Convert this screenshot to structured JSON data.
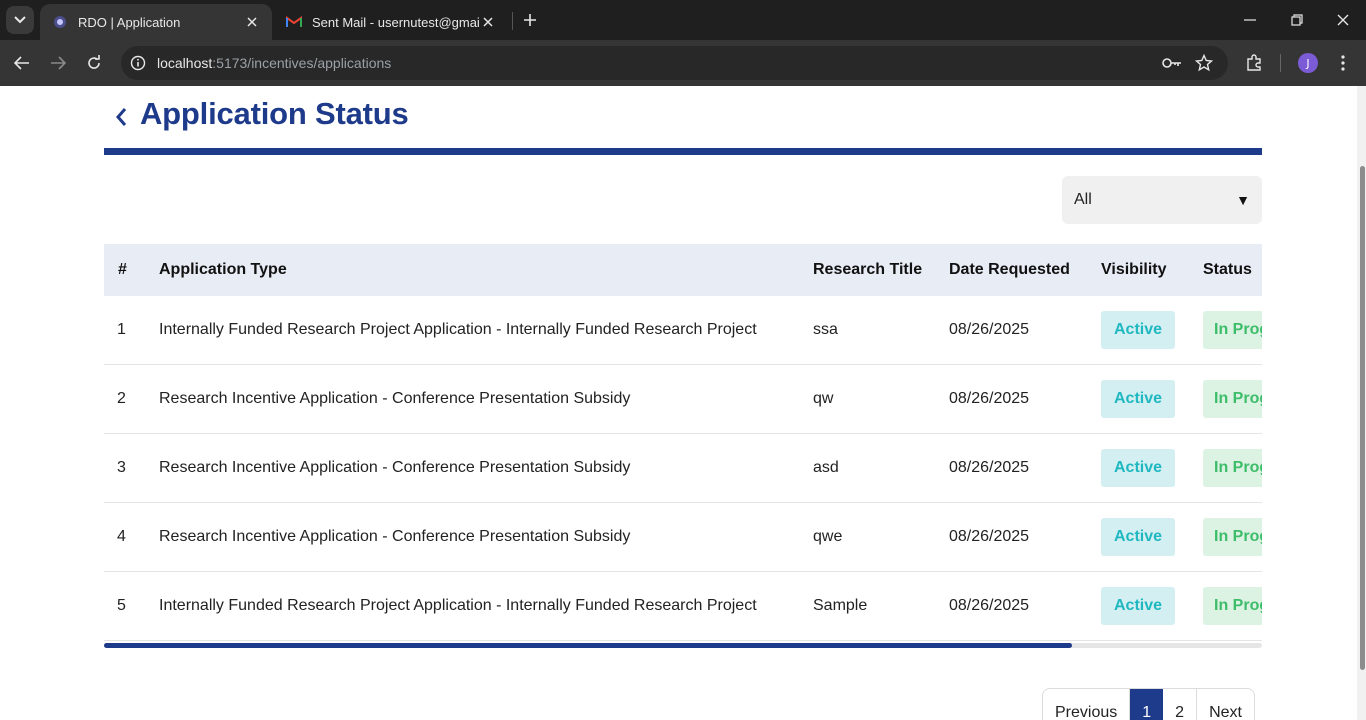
{
  "browser": {
    "tabs": [
      {
        "title": "RDO | Application",
        "active": true
      },
      {
        "title": "Sent Mail - usernutest@gmail.c",
        "active": false
      }
    ],
    "url_host": "localhost",
    "url_rest": ":5173/incentives/applications",
    "profile_initial": "J"
  },
  "page": {
    "title": "Application Status",
    "filter": {
      "selected": "All"
    },
    "table": {
      "columns": [
        "#",
        "Application Type",
        "Research Title",
        "Date Requested",
        "Visibility",
        "Status"
      ],
      "rows": [
        {
          "num": "1",
          "type": "Internally Funded Research Project Application - Internally Funded Research Project",
          "title": "ssa",
          "date": "08/26/2025",
          "visibility": "Active",
          "status": "In Progress"
        },
        {
          "num": "2",
          "type": "Research Incentive Application - Conference Presentation Subsidy",
          "title": "qw",
          "date": "08/26/2025",
          "visibility": "Active",
          "status": "In Progress"
        },
        {
          "num": "3",
          "type": "Research Incentive Application - Conference Presentation Subsidy",
          "title": "asd",
          "date": "08/26/2025",
          "visibility": "Active",
          "status": "In Progress"
        },
        {
          "num": "4",
          "type": "Research Incentive Application - Conference Presentation Subsidy",
          "title": "qwe",
          "date": "08/26/2025",
          "visibility": "Active",
          "status": "In Progress"
        },
        {
          "num": "5",
          "type": "Internally Funded Research Project Application - Internally Funded Research Project",
          "title": "Sample",
          "date": "08/26/2025",
          "visibility": "Active",
          "status": "In Progress"
        }
      ]
    },
    "pagination": {
      "previous": "Previous",
      "pages": [
        "1",
        "2"
      ],
      "current": "1",
      "next": "Next"
    }
  },
  "colors": {
    "accent": "#1e3a8a",
    "active_badge": "#1fb8c0",
    "status_badge": "#3dbd6a"
  }
}
